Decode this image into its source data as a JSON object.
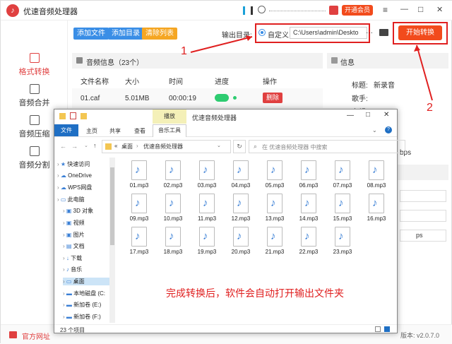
{
  "app": {
    "title": "优速音频处理器",
    "logo_glyph": "♪",
    "vip_label": "开通会员",
    "window_controls": [
      "≡",
      "—",
      "□",
      "✕"
    ],
    "toolbar": {
      "add_file": "添加文件",
      "add_dir": "添加目录",
      "clear_list": "清除列表",
      "output_label": "输出目录:",
      "custom_label": "自定义",
      "output_path": "C:\\Users\\admin\\Deskto",
      "more": "···",
      "start": "开始转换"
    },
    "sidebar": [
      {
        "label": "格式转换",
        "active": true
      },
      {
        "label": "音频合并",
        "active": false
      },
      {
        "label": "音频压缩",
        "active": false
      },
      {
        "label": "音频分割",
        "active": false
      }
    ],
    "list": {
      "header": "音频信息（23个）",
      "columns": [
        "文件名称",
        "大小",
        "时间",
        "进度",
        "操作"
      ],
      "rows": [
        {
          "name": "01.caf",
          "size": "5.01MB",
          "time": "00:00:19",
          "progress": 1.0,
          "action": "删除"
        }
      ]
    },
    "info": {
      "header": "信息",
      "title_label": "标题:",
      "title_value": "新录音",
      "artist_label": "歌手:",
      "album_label": "专辑:",
      "bps_fragment": "bps",
      "bps_fragment2": "ps"
    },
    "footer": {
      "website": "官方网址",
      "version": "版本: v2.0.7.0"
    }
  },
  "explorer": {
    "title": "优速音频处理器",
    "ribbon_context": "播放",
    "tabs": [
      "文件",
      "主页",
      "共享",
      "查看",
      "音乐工具"
    ],
    "address": [
      "«",
      "桌面",
      "›",
      "优速音频处理器"
    ],
    "search_placeholder": "在 优速音频处理器 中搜索",
    "nav": [
      {
        "label": "快速访问",
        "indent": 0,
        "icon": "★"
      },
      {
        "label": "OneDrive",
        "indent": 0,
        "icon": "☁"
      },
      {
        "label": "WPS网盘",
        "indent": 0,
        "icon": "☁"
      },
      {
        "label": "此电脑",
        "indent": 0,
        "icon": "▭"
      },
      {
        "label": "3D 对象",
        "indent": 1,
        "icon": "▣"
      },
      {
        "label": "视频",
        "indent": 1,
        "icon": "▣"
      },
      {
        "label": "图片",
        "indent": 1,
        "icon": "▣"
      },
      {
        "label": "文档",
        "indent": 1,
        "icon": "▤"
      },
      {
        "label": "下载",
        "indent": 1,
        "icon": "↓"
      },
      {
        "label": "音乐",
        "indent": 1,
        "icon": "♪"
      },
      {
        "label": "桌面",
        "indent": 1,
        "icon": "▭",
        "selected": true
      },
      {
        "label": "本地磁盘 (C:",
        "indent": 1,
        "icon": "▬"
      },
      {
        "label": "新加卷 (E:)",
        "indent": 1,
        "icon": "▬"
      },
      {
        "label": "新加卷 (F:)",
        "indent": 1,
        "icon": "▬"
      }
    ],
    "files": [
      "01.mp3",
      "02.mp3",
      "03.mp3",
      "04.mp3",
      "05.mp3",
      "06.mp3",
      "07.mp3",
      "08.mp3",
      "09.mp3",
      "10.mp3",
      "11.mp3",
      "12.mp3",
      "13.mp3",
      "14.mp3",
      "15.mp3",
      "16.mp3",
      "17.mp3",
      "18.mp3",
      "19.mp3",
      "20.mp3",
      "21.mp3",
      "22.mp3",
      "23.mp3"
    ],
    "status": "23 个项目",
    "note": "完成转换后，软件会自动打开输出文件夹"
  },
  "annotations": {
    "one": "1",
    "two": "2"
  },
  "colors": {
    "accent_red": "#e04040",
    "btn_blue": "#3a8ee6",
    "btn_orange": "#f5a623",
    "start_red": "#f24b1c",
    "progress_green": "#2ecc71",
    "annotation_red": "#e02020"
  }
}
